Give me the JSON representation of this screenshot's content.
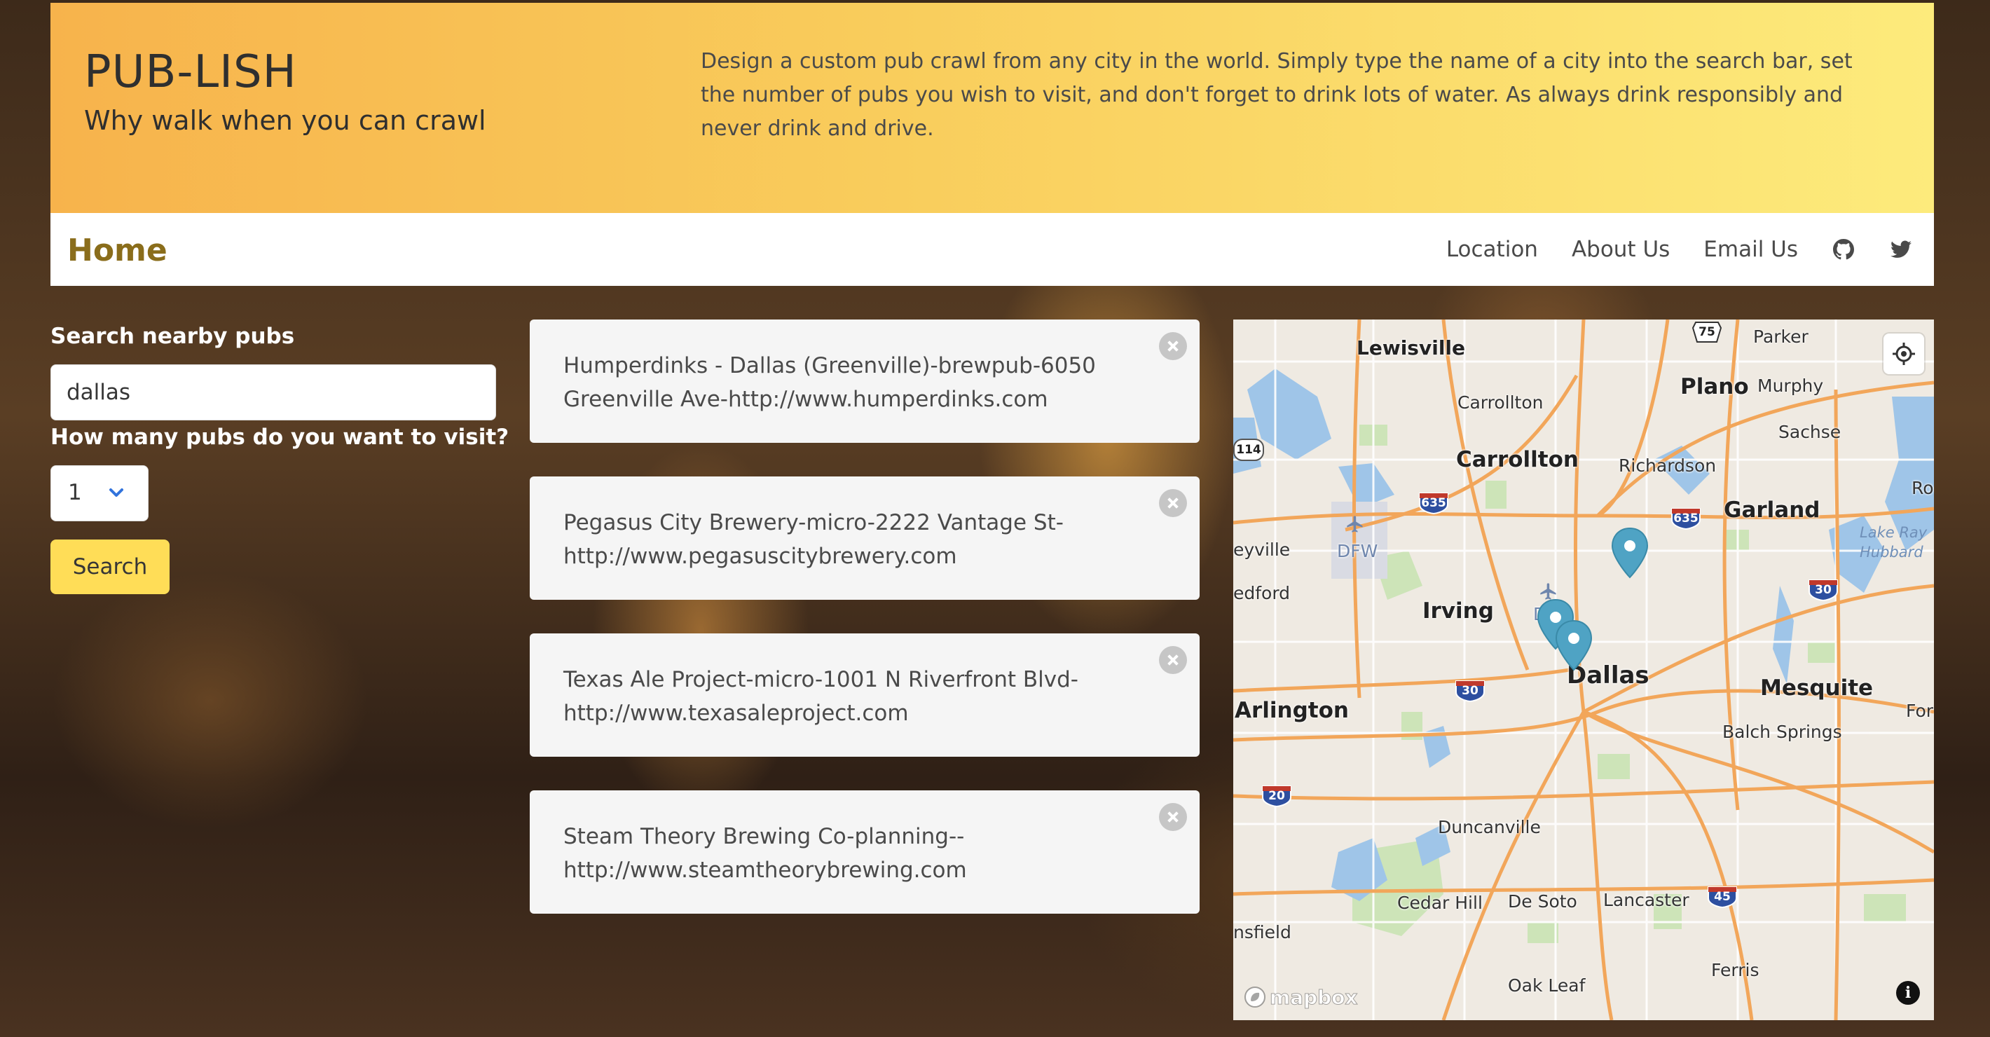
{
  "header": {
    "title": "PUB-LISH",
    "subtitle": "Why walk when you can crawl",
    "description": "Design a custom pub crawl from any city in the world. Simply type the name of a city into the search bar, set the number of pubs you wish to visit, and don't forget to drink lots of water. As always drink responsibly and never drink and drive."
  },
  "nav": {
    "home": "Home",
    "links": [
      "Location",
      "About Us",
      "Email Us"
    ],
    "icons": [
      "github-icon",
      "twitter-icon"
    ]
  },
  "search": {
    "label": "Search nearby pubs",
    "value": "dallas",
    "count_label": "How many pubs do you want to visit?",
    "count_value": "1",
    "button": "Search"
  },
  "results": [
    {
      "line1": "Humperdinks - Dallas (Greenville)-brewpub-6050",
      "line2": "Greenville Ave-http://www.humperdinks.com"
    },
    {
      "line1": "Pegasus City Brewery-micro-2222 Vantage St-",
      "line2": "http://www.pegasuscitybrewery.com"
    },
    {
      "line1": "Texas Ale Project-micro-1001 N Riverfront Blvd-",
      "line2": "http://www.texasaleproject.com"
    },
    {
      "line1": "Steam Theory Brewing Co-planning--",
      "line2": "http://www.steamtheorybrewing.com"
    }
  ],
  "map": {
    "attribution": "mapbox",
    "info": "i",
    "places": {
      "lewisville": "Lewisville",
      "parker": "Parker",
      "plano": "Plano",
      "murphy": "Murphy",
      "carrollton_sm": "Carrollton",
      "carrollton": "Carrollton",
      "sachse": "Sachse",
      "richardson": "Richardson",
      "garland": "Garland",
      "roc": "Roc",
      "dfw": "DFW",
      "eyville": "eyville",
      "edford": "edford",
      "irving": "Irving",
      "d": "D",
      "dallas": "Dallas",
      "mesquite": "Mesquite",
      "arlington": "Arlington",
      "balch": "Balch Springs",
      "for": "For",
      "duncanville": "Duncanville",
      "cedar_hill": "Cedar Hill",
      "desoto": "De Soto",
      "lancaster": "Lancaster",
      "nsfield": "nsfield",
      "oak_leaf": "Oak Leaf",
      "ferris": "Ferris",
      "lake": "Lake Ray Hubbard",
      "hwy_114": "114"
    },
    "shields": {
      "s635a": "635",
      "s635b": "635",
      "s75": "75",
      "s30a": "30",
      "s30b": "30",
      "s20": "20",
      "s45": "45"
    }
  }
}
